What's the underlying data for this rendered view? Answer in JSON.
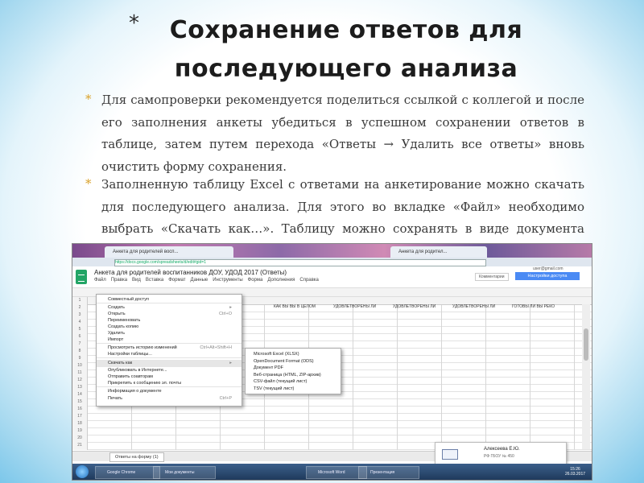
{
  "slide": {
    "title_line1": "Сохранение ответов для",
    "title_line2": "последующего анализа",
    "bullet_glyph": "*",
    "paragraph1": "Для самопроверки рекомендуется поделиться ссылкой с коллегой и после его заполнения анкеты убедиться в успешном сохранении ответов в таблице, затем путем перехода «Ответы → Удалить все ответы» вновь очистить форму сохранения.",
    "paragraph2": "Заполненную таблицу Excel с ответами на анкетирование можно скачать для последующего анализа. Для этого во вкладке «Файл» необходимо выбрать «Скачать как…». Таблицу можно сохранять в виде документа Excel, PDF, CSV"
  },
  "screenshot": {
    "browser_tab1": "Анкета для родителей восп...",
    "browser_tab2": "Анкета для родител...",
    "url": "https://docs.google.com/spreadsheets/d/edit#gid=1",
    "doc_title": "Анкета для родителей воспитанников ДОУ, УДОД 2017 (Ответы)",
    "menu": [
      "Файл",
      "Правка",
      "Вид",
      "Вставка",
      "Формат",
      "Данные",
      "Инструменты",
      "Форма",
      "Дополнения",
      "Справка"
    ],
    "comments_label": "Комментарии",
    "share_label": "Настройки доступа",
    "user_email": "user@gmail.com",
    "question_headers": [
      "КАК ВЫ ВЫ В ЦЕЛОМ",
      "УДОВЛЕТВОРЕНЫ ЛИ",
      "УДОВЛЕТВОРЕНЫ ЛИ",
      "УДОВЛЕТВОРЕНЫ ЛИ",
      "ГОТОВЫ ЛИ ВЫ РЕКО"
    ],
    "file_menu": [
      {
        "label": "Совместный доступ",
        "shortcut": ""
      },
      {
        "label": "Создать",
        "shortcut": "▸"
      },
      {
        "label": "Открыть",
        "shortcut": "Ctrl+O"
      },
      {
        "label": "Переименовать",
        "shortcut": ""
      },
      {
        "label": "Создать копию",
        "shortcut": ""
      },
      {
        "label": "Удалить",
        "shortcut": ""
      },
      {
        "label": "Импорт",
        "shortcut": ""
      },
      {
        "label": "Просмотреть историю изменений",
        "shortcut": "Ctrl+Alt+Shift+H"
      },
      {
        "label": "Настройки таблицы...",
        "shortcut": ""
      },
      {
        "label": "Скачать как",
        "shortcut": "▸"
      },
      {
        "label": "Опубликовать в Интернете...",
        "shortcut": ""
      },
      {
        "label": "Отправить соавторам",
        "shortcut": ""
      },
      {
        "label": "Прикрепить к сообщению эл. почты",
        "shortcut": ""
      },
      {
        "label": "Информация о документе",
        "shortcut": ""
      },
      {
        "label": "Печать",
        "shortcut": "Ctrl+P"
      }
    ],
    "download_submenu": [
      "Microsoft Excel (XLSX)",
      "OpenDocument Format (ODS)",
      "Документ PDF",
      "Веб-страница (HTML, ZIP-архив)",
      "CSV-файл (текущий лист)",
      "TSV (текущий лист)"
    ],
    "sheet_tab": "Ответы на форму (1)",
    "notification_name": "Алексеева Е.Ю.",
    "notification_sub": "РФ ГБОУ № 450",
    "taskbar_items": [
      "Google Chrome",
      "Мои документы",
      "Microsoft Word",
      "Презентация"
    ],
    "clock_time": "15:26",
    "clock_date": "26.03.2017"
  },
  "colors": {
    "bullet": "#d9a12a",
    "sheets_green": "#23a566",
    "share_blue": "#4a8af4",
    "background_edge": "#7cc7ea"
  }
}
